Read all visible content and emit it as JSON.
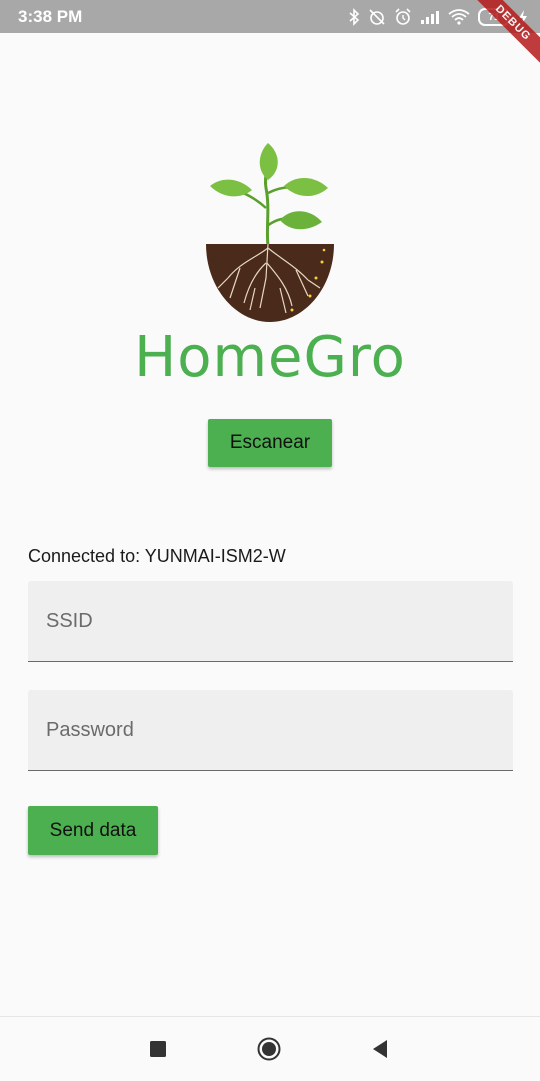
{
  "status_bar": {
    "time": "3:38 PM",
    "battery_level": "71",
    "icons": [
      "bluetooth-icon",
      "alarm-off-icon",
      "alarm-icon",
      "signal-icon",
      "wifi-icon",
      "battery-icon",
      "charging-icon"
    ],
    "debug_label": "DEBUG"
  },
  "app": {
    "brand_name": "HomeGro",
    "brand_color": "#4caf50",
    "logo_icon": "plant-roots-logo"
  },
  "actions": {
    "scan_label": "Escanear",
    "send_label": "Send data"
  },
  "connection": {
    "label": "Connected to: YUNMAI-ISM2-W"
  },
  "form": {
    "ssid_placeholder": "SSID",
    "password_placeholder": "Password"
  },
  "navigation": {
    "items": [
      "recent-apps-icon",
      "home-icon",
      "back-icon"
    ]
  }
}
